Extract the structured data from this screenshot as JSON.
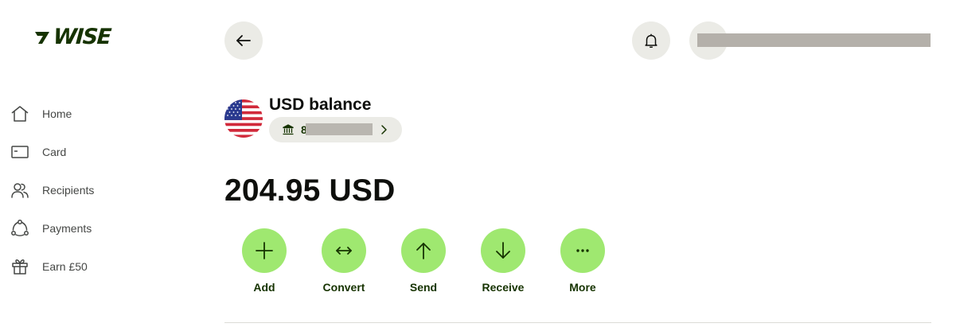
{
  "brand": {
    "logo_text": "WISE",
    "color": "#163300"
  },
  "sidebar": {
    "items": [
      {
        "label": "Home",
        "icon": "home-icon"
      },
      {
        "label": "Card",
        "icon": "card-icon"
      },
      {
        "label": "Recipients",
        "icon": "recipients-icon"
      },
      {
        "label": "Payments",
        "icon": "payments-icon"
      },
      {
        "label": "Earn £50",
        "icon": "gift-icon"
      }
    ]
  },
  "header": {
    "back_icon": "arrow-left-icon",
    "notifications_icon": "bell-icon"
  },
  "balance": {
    "title": "USD balance",
    "account_number_partial": "85",
    "currency_flag": "us-flag",
    "amount": "204.95 USD"
  },
  "actions": [
    {
      "label": "Add",
      "icon": "plus-icon"
    },
    {
      "label": "Convert",
      "icon": "convert-icon"
    },
    {
      "label": "Send",
      "icon": "arrow-up-icon"
    },
    {
      "label": "Receive",
      "icon": "arrow-down-icon"
    },
    {
      "label": "More",
      "icon": "more-icon"
    }
  ],
  "colors": {
    "accent": "#9fe870",
    "accent_text": "#163300",
    "neutral_bg": "#ebebe6",
    "redaction": "#b4b0aa"
  }
}
